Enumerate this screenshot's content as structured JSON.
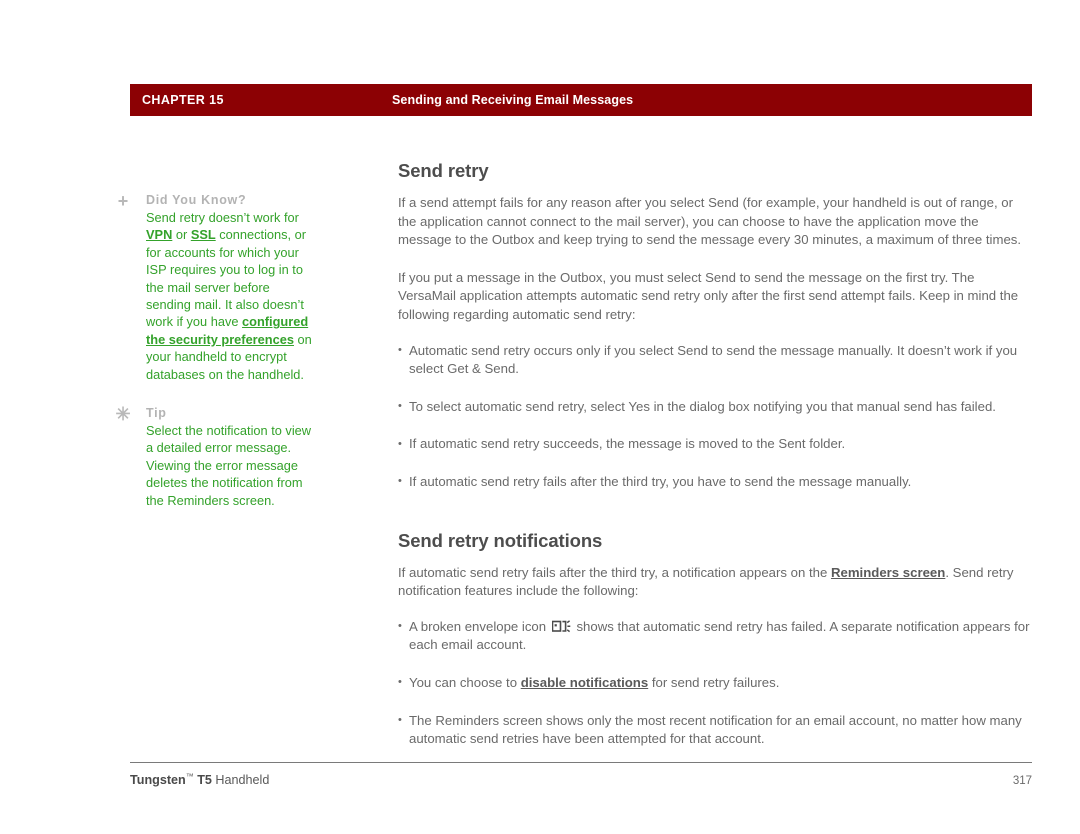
{
  "colors": {
    "header_band": "#8c0104",
    "note_green": "#34a22b",
    "note_label_gray": "#b3b3b3",
    "body_gray": "#6a6a6a",
    "heading_gray": "#4d4d4d"
  },
  "header": {
    "chapter": "CHAPTER 15",
    "section": "Sending and Receiving Email Messages"
  },
  "sidebar": {
    "notes": [
      {
        "icon": "plus-icon",
        "icon_glyph": "+",
        "label": "Did You Know?",
        "segments": [
          {
            "text": "Send retry doesn’t work for ",
            "link": false
          },
          {
            "text": "VPN",
            "link": true
          },
          {
            "text": " or ",
            "link": false
          },
          {
            "text": "SSL",
            "link": true
          },
          {
            "text": " connections, or for accounts for which your ISP requires you to log in to the mail server before sending mail. It also doesn’t work if you have ",
            "link": false
          },
          {
            "text": "configured the security preferences",
            "link": true
          },
          {
            "text": " on your handheld to encrypt databases on the handheld.",
            "link": false
          }
        ]
      },
      {
        "icon": "asterisk-icon",
        "icon_glyph": "✳",
        "label": "Tip",
        "segments": [
          {
            "text": "Select the notification to view a detailed error message. Viewing the error message deletes the notification from the Reminders screen.",
            "link": false
          }
        ]
      }
    ]
  },
  "main": {
    "title_1": "Send retry",
    "para_1": "If a send attempt fails for any reason after you select Send (for example, your handheld is out of range, or the application cannot connect to the mail server), you can choose to have the application move the message to the Outbox and keep trying to send the message every 30 minutes, a maximum of three times.",
    "para_2": "If you put a message in the Outbox, you must select Send to send the message on the first try. The VersaMail application attempts automatic send retry only after the first send attempt fails. Keep in mind the following regarding automatic send retry:",
    "bullets_1": [
      "Automatic send retry occurs only if you select Send to send the message manually. It doesn’t work if you select Get & Send.",
      "To select automatic send retry, select Yes in the dialog box notifying you that manual send has failed.",
      "If automatic send retry succeeds, the message is moved to the Sent folder.",
      "If automatic send retry fails after the third try, you have to send the message manually."
    ],
    "title_2": "Send retry notifications",
    "para_3_pre": "If automatic send retry fails after the third try, a notification appears on the ",
    "para_3_link": "Reminders screen",
    "para_3_post": ". Send retry notification features include the following:",
    "bullet_envelope_pre": "A broken envelope icon ",
    "bullet_envelope_icon": "broken-envelope-icon",
    "bullet_envelope_post": " shows that automatic send retry has failed. A separate notification appears for each email account.",
    "bullet_disable_pre": "You can choose to ",
    "bullet_disable_link": "disable notifications",
    "bullet_disable_post": " for send retry failures.",
    "bullet_last": "The Reminders screen shows only the most recent notification for an email account, no matter how many automatic send retries have been attempted for that account."
  },
  "footer": {
    "product_bold": "Tungsten",
    "trademark": "™",
    "model_bold": "T5",
    "product_rest": " Handheld",
    "page_number": "317"
  }
}
